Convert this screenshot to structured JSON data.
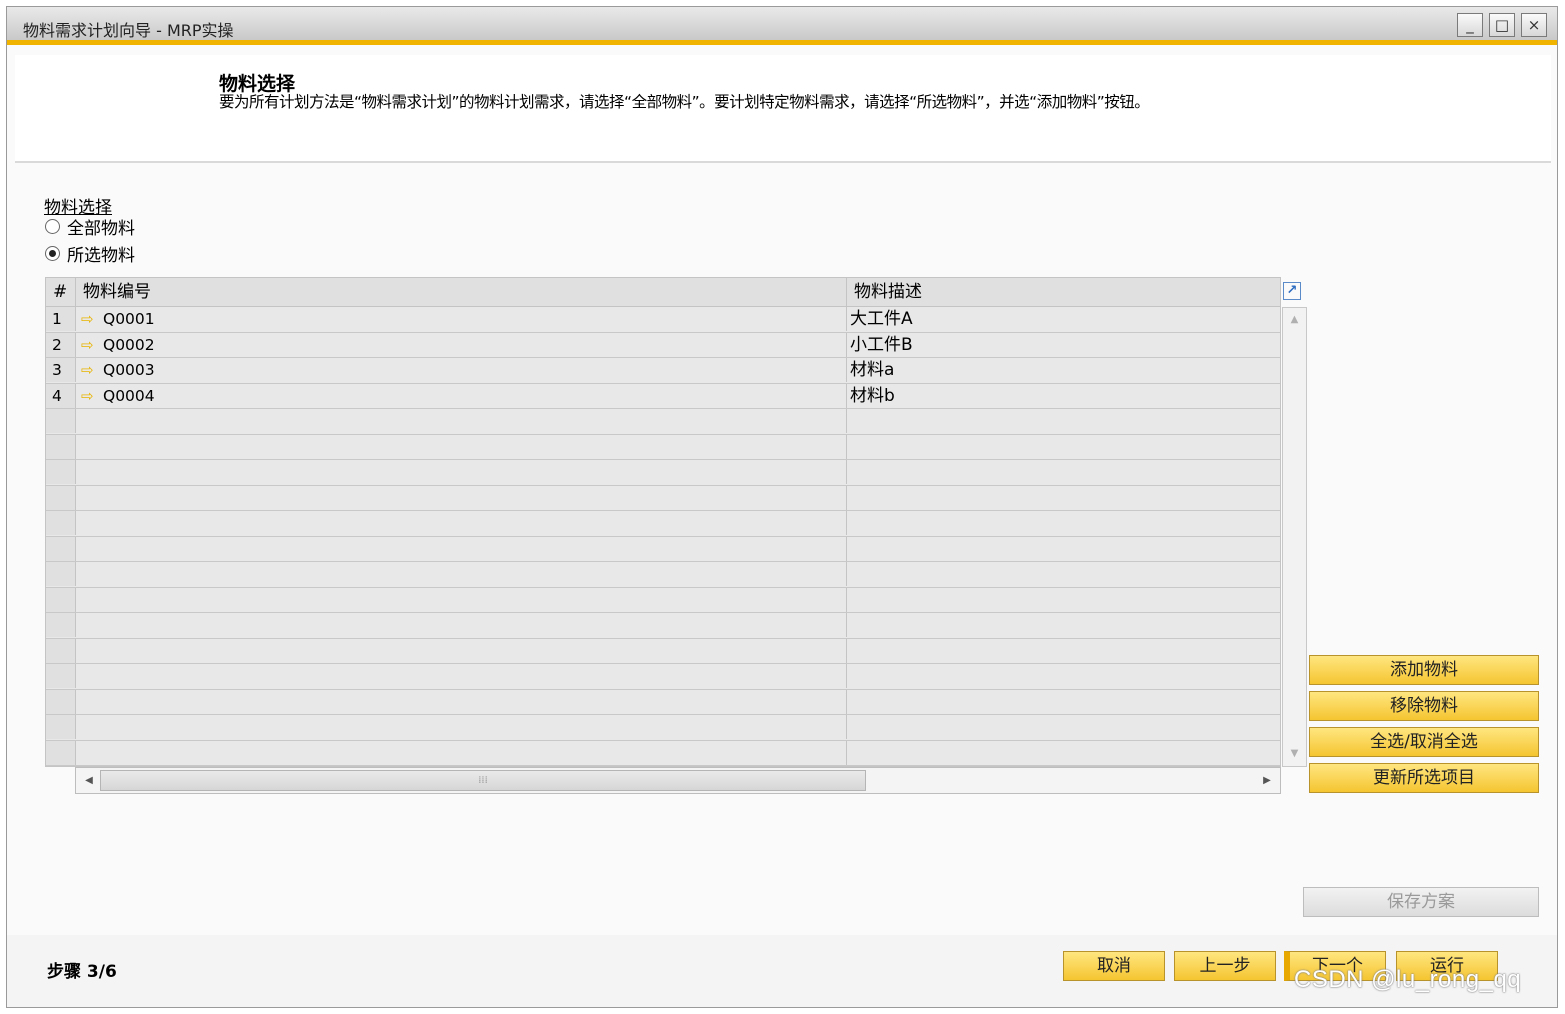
{
  "window": {
    "title": "物料需求计划向导 - MRP实操",
    "minimize": "_",
    "maximize": "□",
    "close": "×"
  },
  "header": {
    "title": "物料选择",
    "description": "要为所有计划方法是“物料需求计划”的物料计划需求，请选择“全部物料”。要计划特定物料需求，请选择“所选物料”，并选“添加物料”按钮。"
  },
  "selection": {
    "label": "物料选择",
    "options": [
      {
        "label": "全部物料",
        "checked": false
      },
      {
        "label": "所选物料",
        "checked": true
      }
    ]
  },
  "grid": {
    "columns": [
      "#",
      "物料编号",
      "物料描述"
    ],
    "rows": [
      {
        "num": "1",
        "code": "Q0001",
        "desc": "大工件A"
      },
      {
        "num": "2",
        "code": "Q0002",
        "desc": "小工件B"
      },
      {
        "num": "3",
        "code": "Q0003",
        "desc": "材料a"
      },
      {
        "num": "4",
        "code": "Q0004",
        "desc": "材料b"
      }
    ],
    "empty_rows": 14
  },
  "side_buttons": {
    "add": "添加物料",
    "remove": "移除物料",
    "toggle_all": "全选/取消全选",
    "update": "更新所选项目",
    "save_scheme": "保存方案"
  },
  "footer": {
    "step": "步骤 3/6",
    "cancel": "取消",
    "prev": "上一步",
    "next": "下一个",
    "run": "运行"
  },
  "watermark": "CSDN @lu_rong_qq",
  "colors": {
    "accent": "#f0b400",
    "button_yellow": "#f5c531",
    "grid_bg": "#e8e8e8"
  },
  "icons": {
    "row_link": "golden-arrow",
    "expand": "expand-arrow-icon"
  }
}
